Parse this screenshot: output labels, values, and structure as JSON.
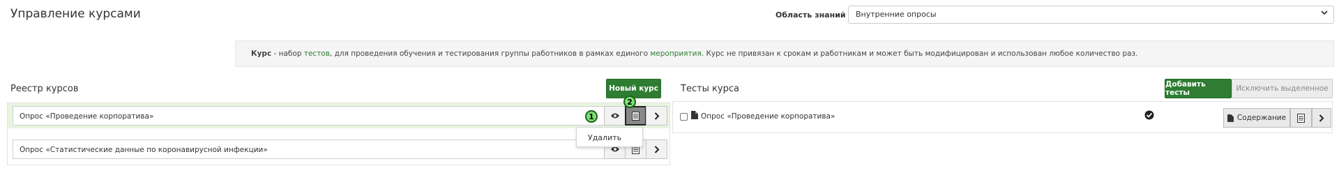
{
  "header": {
    "title": "Управление курсами",
    "knowledge_area_label": "Область знаний",
    "knowledge_area_value": "Внутренние опросы"
  },
  "info": {
    "prefix": "Курс",
    "t1": " - набор ",
    "link1": "тестов",
    "t2": ", для проведения обучения и тестирования группы работников в рамках единого ",
    "link2": "мероприятия",
    "t3": ". Курс не привязан к срокам и работникам и может быть модифицирован и использован любое количество раз."
  },
  "registry": {
    "title": "Реестр курсов",
    "new_button": "Новый курс",
    "courses": [
      {
        "name": "Опрос «Проведение корпоратива»"
      },
      {
        "name": "Опрос «Статистические данные по коронавирусной инфекции»"
      }
    ],
    "dropdown_items": [
      "Удалить"
    ]
  },
  "tests": {
    "title": "Тесты курса",
    "add_button": "Добавить тесты",
    "exclude_button": "Исключить выделенное",
    "items": [
      {
        "name": "Опрос «Проведение корпоратива»",
        "content_button": "Содержание"
      }
    ]
  },
  "annotations": {
    "badge1": "1",
    "badge2": "2"
  },
  "colors": {
    "accent": "#2e7d32",
    "highlight": "#e8f5e0",
    "badge": "#7ee06f"
  }
}
